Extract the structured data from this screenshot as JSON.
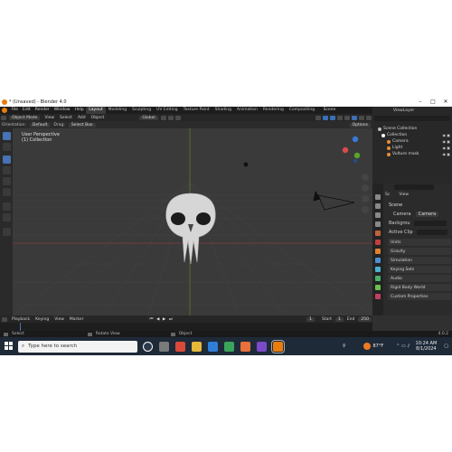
{
  "window": {
    "title": "* (Unsaved) - Blender 4.0",
    "controls": [
      "–",
      "□",
      "✕"
    ]
  },
  "menubar": {
    "menus": [
      "File",
      "Edit",
      "Render",
      "Window",
      "Help"
    ],
    "workspaces": [
      "Layout",
      "Modeling",
      "Sculpting",
      "UV Editing",
      "Texture Paint",
      "Shading",
      "Animation",
      "Rendering",
      "Compositing"
    ],
    "active_workspace": "Layout",
    "scene": "Scene",
    "view_layer": "ViewLayer"
  },
  "header": {
    "mode": "Object Mode",
    "menus": [
      "View",
      "Select",
      "Add",
      "Object"
    ],
    "transform": "Global",
    "options": "Options"
  },
  "toolheader": {
    "orientation_label": "Orientation:",
    "orientation": "Default",
    "drag_label": "Drag:",
    "drag": "Select Box"
  },
  "viewport": {
    "perspective": "User Perspective",
    "collection": "(1) Collection"
  },
  "outliner": {
    "items": [
      {
        "label": "Scene Collection",
        "color": "#bbbbbb"
      },
      {
        "label": "Collection",
        "color": "#ffffff"
      },
      {
        "label": "Camera",
        "color": "#e8903a"
      },
      {
        "label": "Light",
        "color": "#e8903a"
      },
      {
        "label": "Vulture mask",
        "color": "#e8903a"
      }
    ]
  },
  "properties": {
    "search_placeholder": "",
    "tabs": [
      "Sc",
      "View"
    ],
    "scene_section": "Scene",
    "camera_label": "Camera",
    "camera_value": "Camera",
    "background_label": "Backgrou",
    "active_clip_label": "Active Clip",
    "sections": [
      "Units",
      "Gravity",
      "Simulation",
      "Keying Sets",
      "Audio",
      "Rigid Body World",
      "Custom Properties"
    ]
  },
  "timeline": {
    "menus": [
      "Playback",
      "Keying",
      "View",
      "Marker"
    ],
    "current_frame": "1",
    "start_label": "Start",
    "start": "1",
    "end_label": "End",
    "end": "250"
  },
  "status": {
    "select": "Select",
    "rotate": "Rotate View",
    "object": "Object",
    "version": "4.0.2"
  },
  "taskbar": {
    "search_placeholder": "Type here to search",
    "weather": "87°F",
    "time": "10:24 AM",
    "date": "8/1/2024"
  }
}
